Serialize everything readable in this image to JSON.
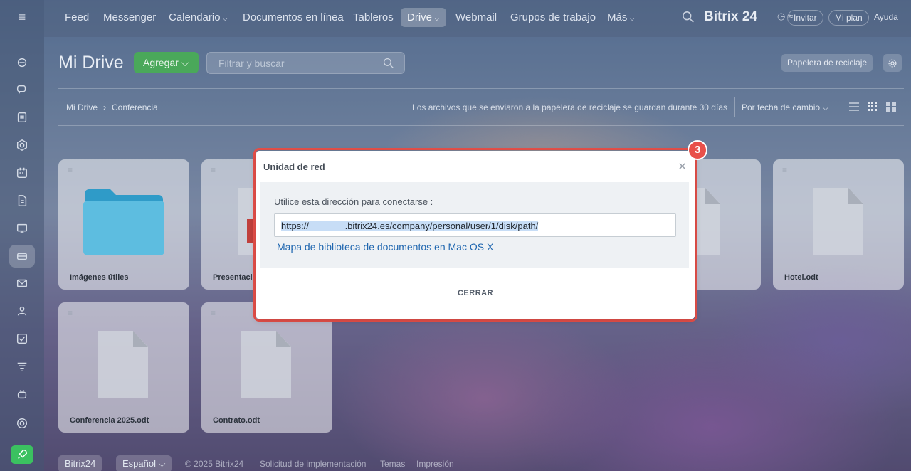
{
  "colors": {
    "accent_green": "#4aa85a",
    "highlight_red": "#e8504a",
    "link_blue": "#2067b0"
  },
  "topnav": {
    "items": [
      {
        "label": "Feed"
      },
      {
        "label": "Messenger"
      },
      {
        "label": "Calendario"
      },
      {
        "label": "Documentos en línea"
      },
      {
        "label": "Tableros"
      },
      {
        "label": "Drive"
      },
      {
        "label": "Webmail"
      },
      {
        "label": "Grupos de trabajo"
      },
      {
        "label": "Más"
      }
    ],
    "brand": "Bitrix 24",
    "invite": "Invitar",
    "plan": "Mi plan",
    "help": "Ayuda"
  },
  "sidebar": {
    "icons": [
      "menu-icon",
      "feed-icon",
      "chat-icon",
      "tasks-icon",
      "sites-icon",
      "calendar-icon",
      "docs-icon",
      "boards-icon",
      "drive-icon",
      "mail-icon",
      "groups-icon",
      "checklist-icon",
      "filter-icon",
      "bot-icon",
      "settings-icon",
      "rocket-icon"
    ]
  },
  "header": {
    "title": "Mi Drive",
    "add_label": "Agregar",
    "search_placeholder": "Filtrar y buscar",
    "trash_label": "Papelera de reciclaje"
  },
  "breadcrumb": {
    "root": "Mi Drive",
    "current": "Conferencia"
  },
  "notice": "Los archivos que se enviaron a la papelera de reciclaje se guardan durante 30 días",
  "sort_label": "Por fecha de cambio",
  "files": [
    {
      "name": "Imágenes útiles",
      "kind": "folder"
    },
    {
      "name": "Presentaci",
      "kind": "presentation"
    },
    {
      "name": "",
      "kind": "document"
    },
    {
      "name": "Hotel.odt",
      "kind": "document"
    },
    {
      "name": "Conferencia 2025.odt",
      "kind": "document"
    },
    {
      "name": "Contrato.odt",
      "kind": "document"
    }
  ],
  "footer": {
    "brand": "Bitrix24",
    "language": "Español",
    "copyright": "© 2025 Bitrix24",
    "links": [
      "Solicitud de implementación",
      "Temas",
      "Impresión"
    ]
  },
  "modal": {
    "title": "Unidad de red",
    "label": "Utilice esta dirección para conectarse :",
    "url": "https://              .bitrix24.es/company/personal/user/1/disk/path/",
    "mac_link": "Mapa de biblioteca de documentos en Mac OS X",
    "close": "CERRAR",
    "step": "3"
  }
}
